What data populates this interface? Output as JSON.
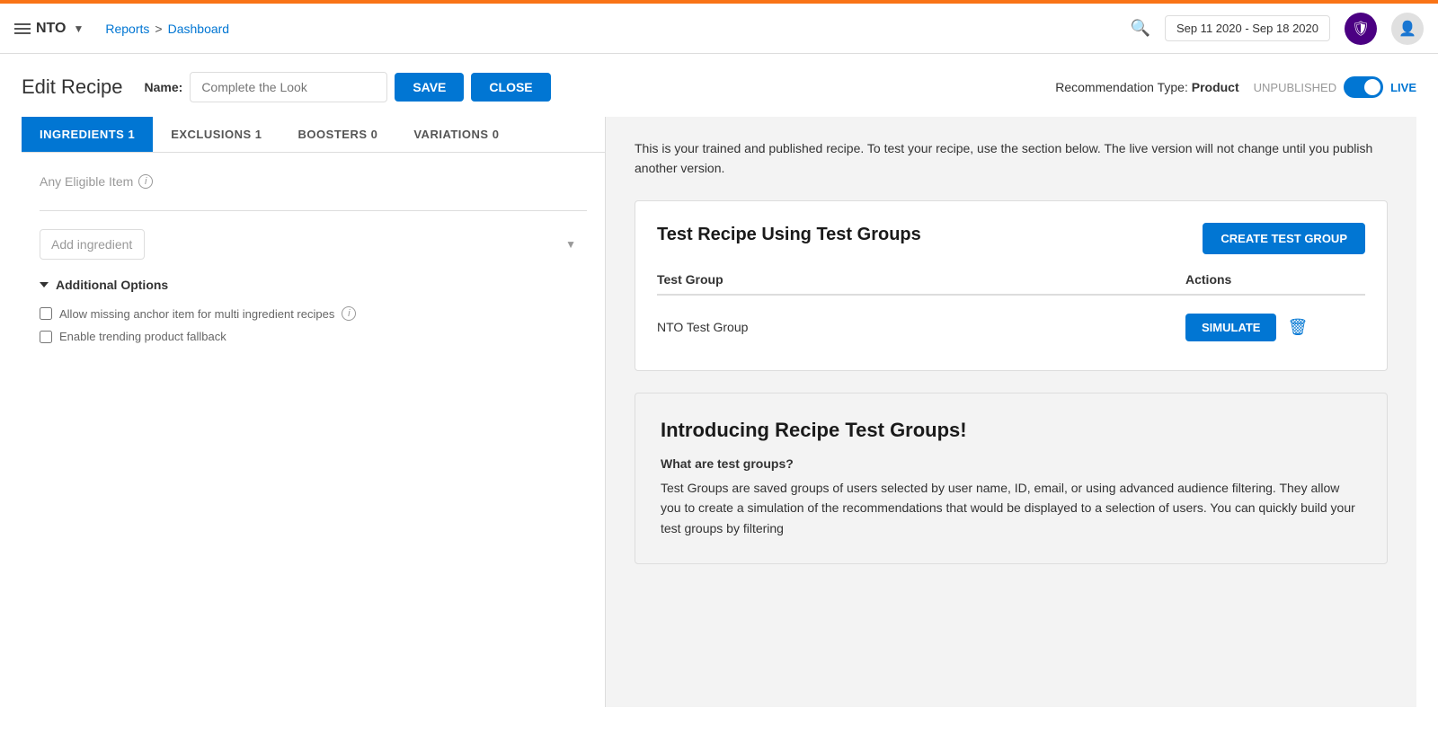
{
  "topbar": {},
  "header": {
    "logo": "NTO",
    "breadcrumb": {
      "reports": "Reports",
      "separator": ">",
      "dashboard": "Dashboard"
    },
    "date_range": "Sep 11 2020 - Sep 18 2020"
  },
  "recipe": {
    "page_title": "Edit Recipe",
    "name_label": "Name:",
    "name_placeholder": "Complete the Look",
    "save_button": "SAVE",
    "close_button": "CLOSE",
    "recommendation_type_label": "Recommendation Type:",
    "recommendation_type_value": "Product",
    "toggle_unpublished": "UNPUBLISHED",
    "toggle_live": "LIVE"
  },
  "tabs": [
    {
      "label": "INGREDIENTS 1",
      "active": true
    },
    {
      "label": "EXCLUSIONS 1",
      "active": false
    },
    {
      "label": "BOOSTERS 0",
      "active": false
    },
    {
      "label": "VARIATIONS 0",
      "active": false
    }
  ],
  "left_panel": {
    "any_eligible_item": "Any Eligible Item",
    "add_ingredient_placeholder": "Add ingredient",
    "additional_options_label": "Additional Options",
    "checkbox1_label": "Allow missing anchor item for multi ingredient recipes",
    "checkbox2_label": "Enable trending product fallback"
  },
  "right_panel": {
    "trained_text": "This is your trained and published recipe. To test your recipe, use the section below. The live version will not change until you publish another version.",
    "test_section": {
      "title": "Test Recipe Using Test Groups",
      "create_button": "CREATE TEST GROUP",
      "col_group": "Test Group",
      "col_actions": "Actions",
      "test_groups": [
        {
          "name": "NTO Test Group",
          "simulate_button": "SIMULATE"
        }
      ]
    },
    "intro_section": {
      "title": "Introducing Recipe Test Groups!",
      "subtitle": "What are test groups?",
      "body": "Test Groups are saved groups of users selected by user name, ID, email, or using advanced audience filtering. They allow you to create a simulation of the recommendations that would be displayed to a selection of users. You can quickly build your test groups by filtering"
    }
  }
}
